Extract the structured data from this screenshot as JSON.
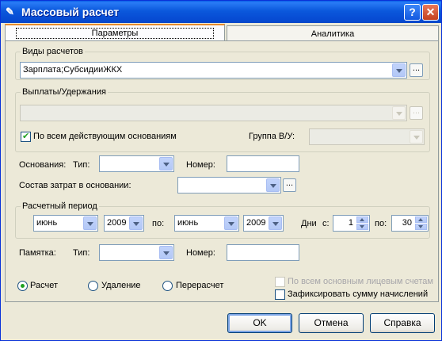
{
  "window": {
    "title": "Массовый расчет",
    "help": "?",
    "close": "✕"
  },
  "tabs": [
    {
      "label": "Параметры"
    },
    {
      "label": "Аналитика"
    }
  ],
  "calc_types": {
    "legend": "Виды расчетов",
    "value": "Зарплата;СубсидииЖКХ",
    "dots": "..."
  },
  "payments": {
    "legend": "Выплаты/Удержания",
    "value": "",
    "all_bases_label": "По всем действующим основаниям",
    "all_bases_checked": true,
    "group_label": "Группа В/У:",
    "dots": "..."
  },
  "basis": {
    "label": "Основания:",
    "type_label": "Тип:",
    "number_label": "Номер:"
  },
  "costs": {
    "label": "Состав затрат в основании:",
    "dots": "..."
  },
  "period": {
    "legend": "Расчетный период",
    "from_month": "июнь",
    "from_year": "2009",
    "to_label": "по:",
    "to_month": "июнь",
    "to_year": "2009",
    "days_label": "Дни",
    "days_from_label": "с:",
    "days_from": "1",
    "days_to_label": "по:",
    "days_to": "30"
  },
  "memo": {
    "label": "Памятка:",
    "type_label": "Тип:",
    "number_label": "Номер:"
  },
  "mode": {
    "options": [
      "Расчет",
      "Удаление",
      "Перерасчет"
    ],
    "selected": "Расчет"
  },
  "options": {
    "all_accounts_label": "По всем основным лицевым счетам",
    "fix_sum_label": "Зафиксировать сумму начислений"
  },
  "buttons": {
    "ok": "OK",
    "cancel": "Отмена",
    "help": "Справка"
  }
}
